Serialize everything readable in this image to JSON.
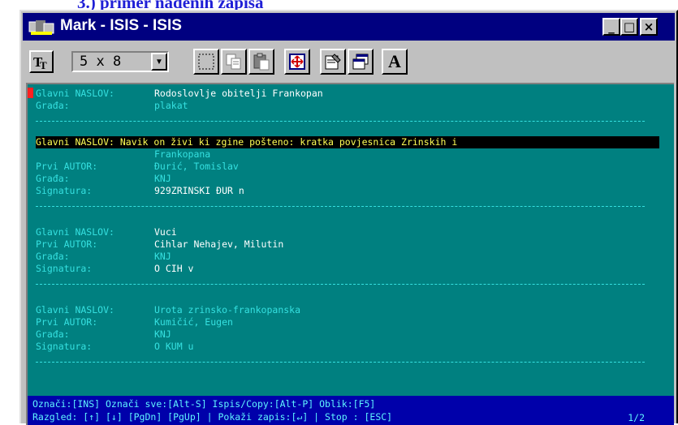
{
  "page": {
    "caption": "3.) primer nadenih zapisa"
  },
  "window": {
    "title": "Mark - ISIS - ISIS",
    "controls": {
      "minimize": "_",
      "maximize": "□",
      "close": "×"
    }
  },
  "toolbar": {
    "font_select": {
      "value": "5 x 8",
      "arrow": "▼"
    },
    "buttons": [
      {
        "icon": "font-icon"
      },
      {
        "icon": "mark-icon"
      },
      {
        "icon": "copy-icon"
      },
      {
        "icon": "paste-icon"
      },
      {
        "icon": "fullscreen-icon"
      },
      {
        "icon": "properties-icon"
      },
      {
        "icon": "background-icon"
      },
      {
        "icon": "font-a-icon",
        "text": "A"
      }
    ]
  },
  "records": [
    {
      "fields": [
        {
          "label": "Glavni NASLOV:",
          "value": "Rodoslovlje obitelji Frankopan"
        },
        {
          "label": "Građa:",
          "value": "plakat"
        }
      ]
    },
    {
      "highlight": "Glavni NASLOV: Navik on živi ki zgine pošteno: kratka povjesnica Zrinskih i",
      "continuation": "Frankopana",
      "fields": [
        {
          "label": "Prvi AUTOR:",
          "value": "Đurić, Tomislav"
        },
        {
          "label": "Građa:",
          "value": "KNJ"
        },
        {
          "label": "Signatura:",
          "value": "929ZRINSKI ĐUR n"
        }
      ]
    },
    {
      "fields": [
        {
          "label": "Glavni NASLOV:",
          "value": "Vuci"
        },
        {
          "label": "Prvi AUTOR:",
          "value": "Cihlar Nehajev, Milutin"
        },
        {
          "label": "Građa:",
          "value": "KNJ"
        },
        {
          "label": "Signatura:",
          "value": "O CIH v"
        }
      ]
    },
    {
      "fields": [
        {
          "label": "Glavni NASLOV:",
          "value": "Urota zrinsko-frankopanska"
        },
        {
          "label": "Prvi AUTOR:",
          "value": "Kumičić, Eugen"
        },
        {
          "label": "Građa:",
          "value": "KNJ"
        },
        {
          "label": "Signatura:",
          "value": "O KUM u"
        }
      ]
    }
  ],
  "status": {
    "line1": "Označi:[INS] Označi sve:[Alt-S] Ispis/Copy:[Alt-P] Oblik:[F5]",
    "line2": "Razgled: [↑] [↓] [PgDn] [PgUp] | Pokaži zapis:[↵] | Stop : [ESC]",
    "page": "1/2"
  },
  "colors": {
    "console_bg": "#008080",
    "text_cyan": "#35e0e0",
    "highlight_bg": "#000000",
    "highlight_fg": "#ffff55",
    "status_bg": "#0000aa",
    "titlebar": "#000080"
  }
}
